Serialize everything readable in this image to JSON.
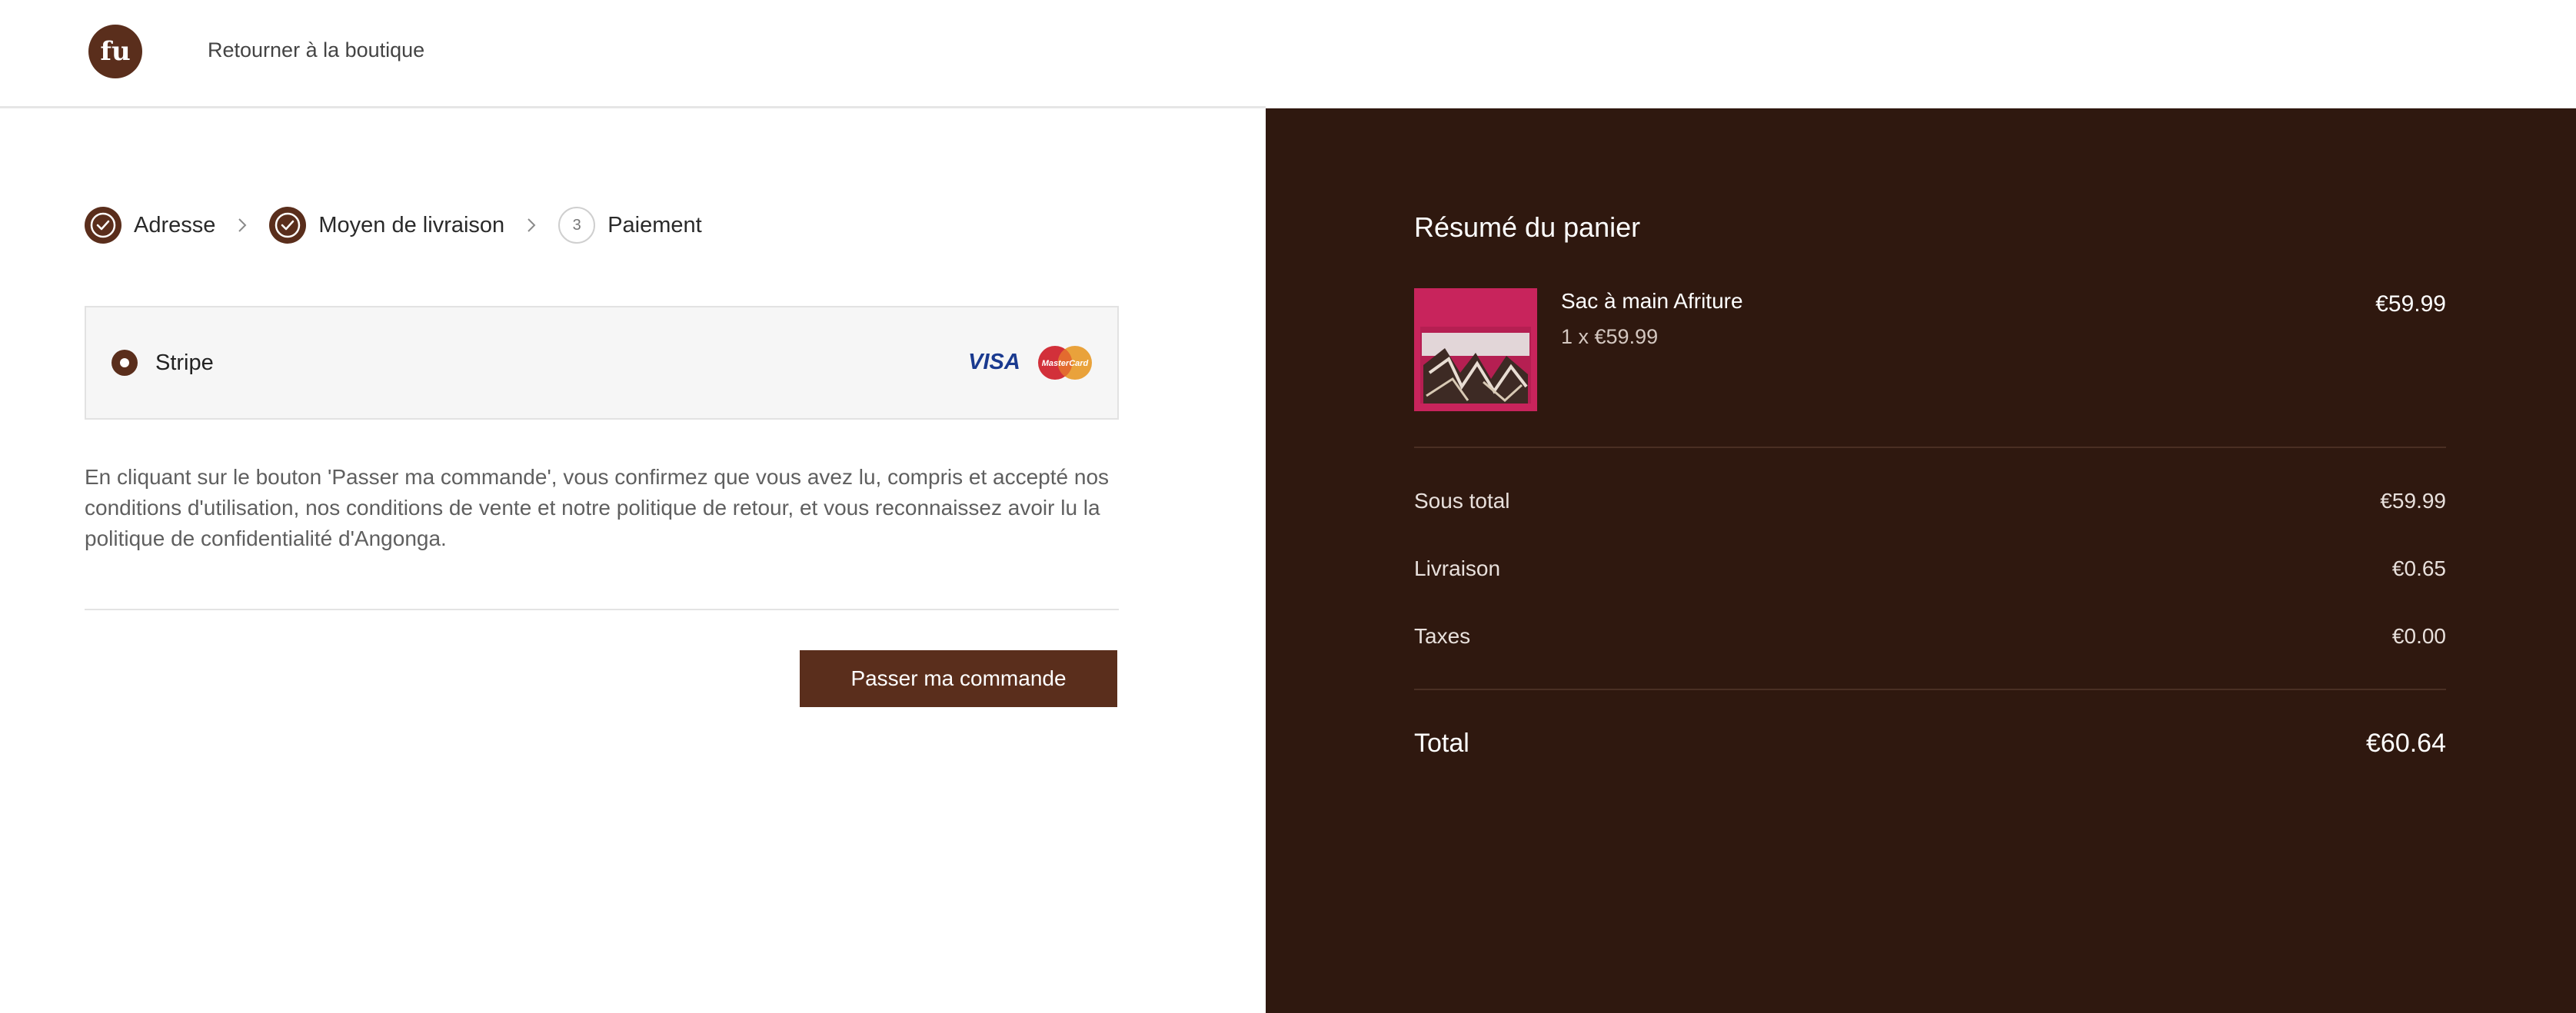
{
  "header": {
    "logo_text": "fu",
    "back_link": "Retourner à la boutique"
  },
  "steps": [
    {
      "label": "Adresse",
      "state": "done"
    },
    {
      "label": "Moyen de livraison",
      "state": "done"
    },
    {
      "label": "Paiement",
      "state": "current",
      "number": "3"
    }
  ],
  "payment": {
    "method_label": "Stripe",
    "selected": true,
    "card_brands": {
      "visa": "VISA",
      "mastercard": "MasterCard"
    }
  },
  "legal_text": "En cliquant sur le bouton 'Passer ma commande', vous confirmez que vous avez lu, compris et accepté nos conditions d'utilisation, nos conditions de vente et notre politique de retour, et vous reconnaissez avoir lu la politique de confidentialité d'Angonga.",
  "order_button": "Passer ma commande",
  "summary": {
    "title": "Résumé du panier",
    "item": {
      "name": "Sac à main Afriture",
      "qty_line": "1 x €59.99",
      "price": "€59.99"
    },
    "subtotal_label": "Sous total",
    "subtotal_value": "€59.99",
    "shipping_label": "Livraison",
    "shipping_value": "€0.65",
    "tax_label": "Taxes",
    "tax_value": "€0.00",
    "total_label": "Total",
    "total_value": "€60.64"
  },
  "colors": {
    "brand_brown": "#5a2e1c",
    "summary_bg": "#2f180f"
  }
}
